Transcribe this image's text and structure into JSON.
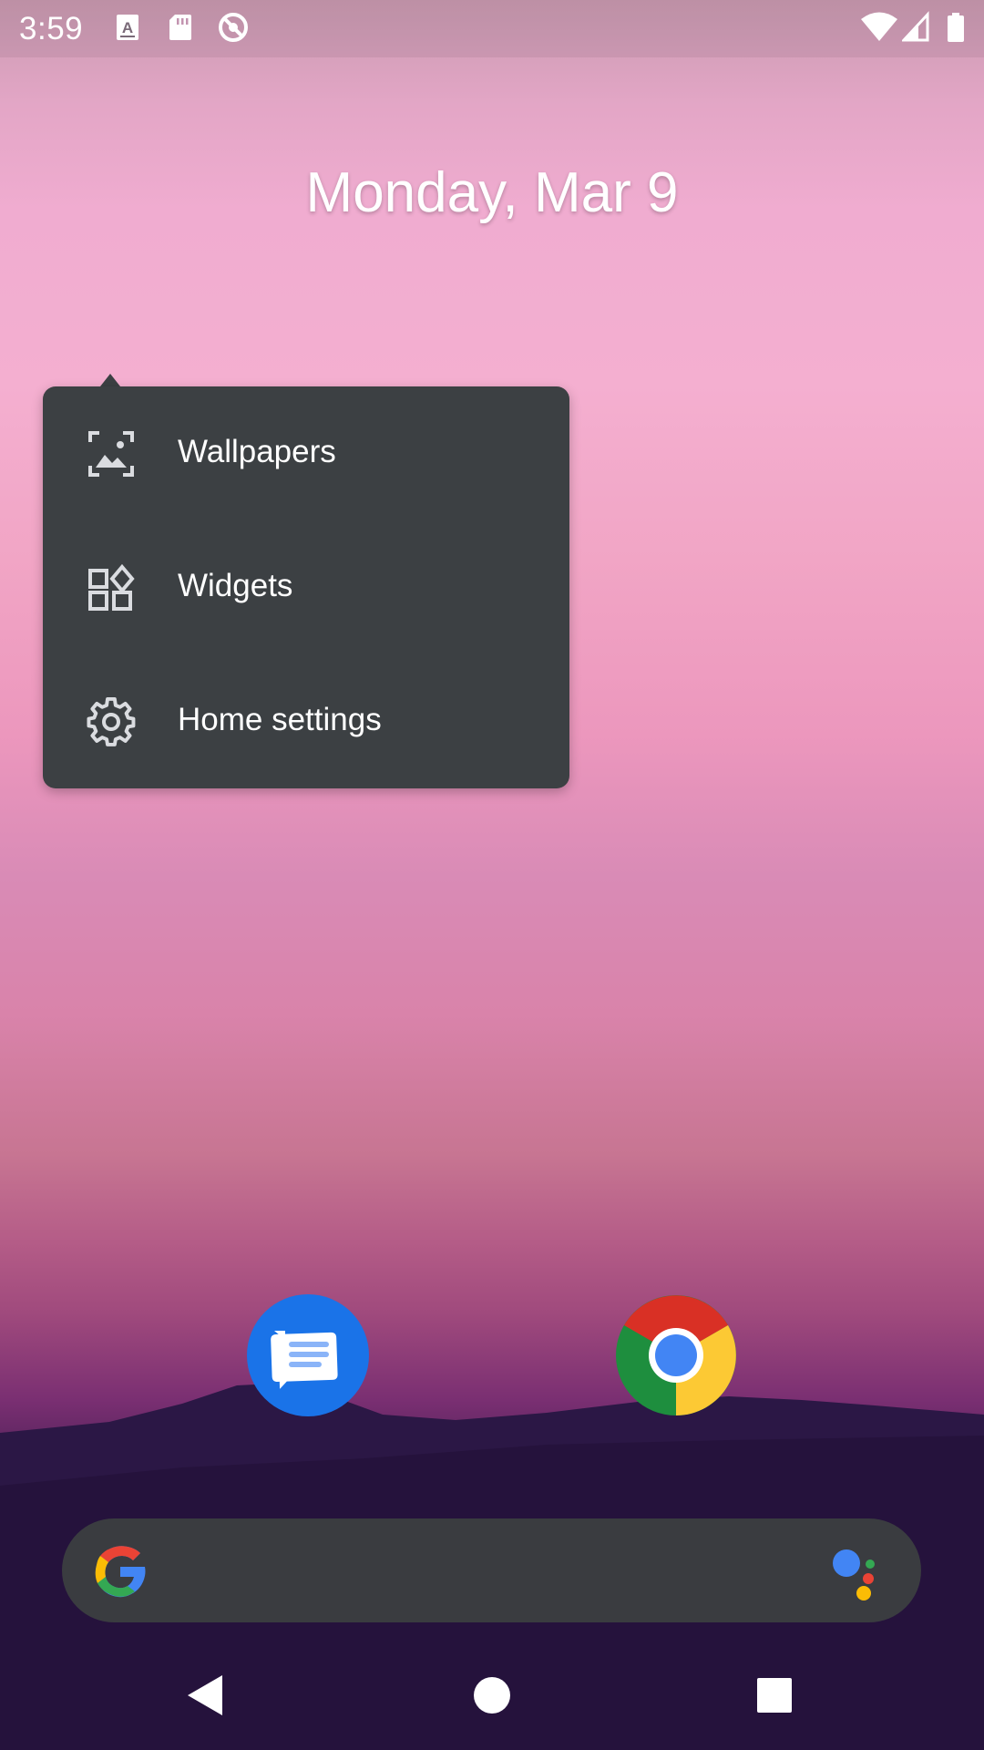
{
  "status_bar": {
    "time": "3:59",
    "left_icons": [
      "a-keyboard-icon",
      "sd-card-icon",
      "no-sync-icon"
    ],
    "right_icons": [
      "wifi-icon",
      "cell-signal-icon",
      "battery-icon"
    ]
  },
  "home": {
    "date": "Monday, Mar 9"
  },
  "context_menu": {
    "items": [
      {
        "label": "Wallpapers",
        "icon": "wallpaper-icon"
      },
      {
        "label": "Widgets",
        "icon": "widgets-icon"
      },
      {
        "label": "Home settings",
        "icon": "gear-icon"
      }
    ]
  },
  "dock": {
    "apps": [
      {
        "icon": "messages-app-icon"
      },
      {
        "icon": "chrome-app-icon"
      }
    ]
  },
  "search_bar": {
    "left_icon": "google-g-icon",
    "right_icon": "google-assistant-icon"
  },
  "nav_bar": {
    "buttons": [
      "back-icon",
      "home-icon",
      "recents-icon"
    ]
  },
  "colors": {
    "menu_bg": "#3c4043",
    "search_bg": "#3a3c40",
    "messages_blue": "#1a73e8"
  }
}
